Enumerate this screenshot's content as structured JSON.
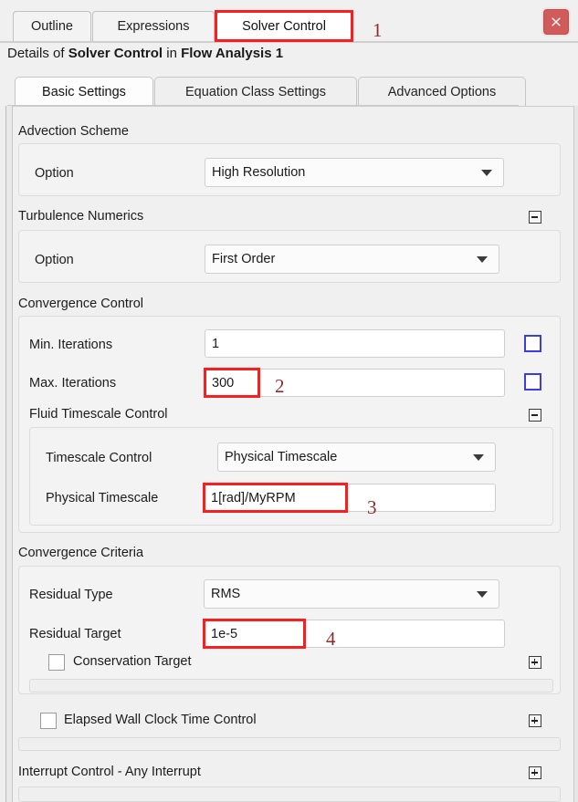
{
  "window": {
    "close_icon": "close-icon"
  },
  "top_tabs": [
    {
      "label": "Outline",
      "active": false
    },
    {
      "label": "Expressions",
      "active": false
    },
    {
      "label": "Solver Control",
      "active": true
    }
  ],
  "details": {
    "prefix": "Details of ",
    "object": "Solver Control",
    "middle": " in ",
    "context": "Flow Analysis 1"
  },
  "inner_tabs": [
    {
      "label": "Basic Settings",
      "active": true
    },
    {
      "label": "Equation Class Settings",
      "active": false
    },
    {
      "label": "Advanced Options",
      "active": false
    }
  ],
  "sections": {
    "advection": {
      "title": "Advection Scheme",
      "option_label": "Option",
      "option_value": "High Resolution"
    },
    "turbulence": {
      "title": "Turbulence Numerics",
      "expander": "collapse-icon",
      "option_label": "Option",
      "option_value": "First Order"
    },
    "convergence_control": {
      "title": "Convergence Control",
      "min_iterations_label": "Min. Iterations",
      "min_iterations_value": "1",
      "max_iterations_label": "Max. Iterations",
      "max_iterations_value": "300",
      "fluid_timescale": {
        "title": "Fluid Timescale Control",
        "expander": "collapse-icon",
        "timescale_control_label": "Timescale Control",
        "timescale_control_value": "Physical Timescale",
        "physical_timescale_label": "Physical Timescale",
        "physical_timescale_value": "1[rad]/MyRPM"
      }
    },
    "convergence_criteria": {
      "title": "Convergence Criteria",
      "residual_type_label": "Residual Type",
      "residual_type_value": "RMS",
      "residual_target_label": "Residual Target",
      "residual_target_value": "1e-5",
      "conservation_target_label": "Conservation Target",
      "conservation_target_expander": "expand-icon"
    },
    "elapsed_wall_clock": {
      "label": "Elapsed Wall Clock Time Control",
      "expander": "expand-icon"
    },
    "interrupt_control": {
      "title": "Interrupt Control - Any Interrupt",
      "expander": "expand-icon"
    }
  },
  "annotations": [
    {
      "number": "1",
      "target": "solver-control-tab"
    },
    {
      "number": "2",
      "target": "max-iterations-field"
    },
    {
      "number": "3",
      "target": "physical-timescale-field"
    },
    {
      "number": "4",
      "target": "residual-target-field"
    }
  ],
  "colors": {
    "highlight": "#fa1f1f",
    "annotation_text": "#8e2b2b",
    "checkbox_blue": "#3d3ddb",
    "close_button": "#d05b5b"
  }
}
